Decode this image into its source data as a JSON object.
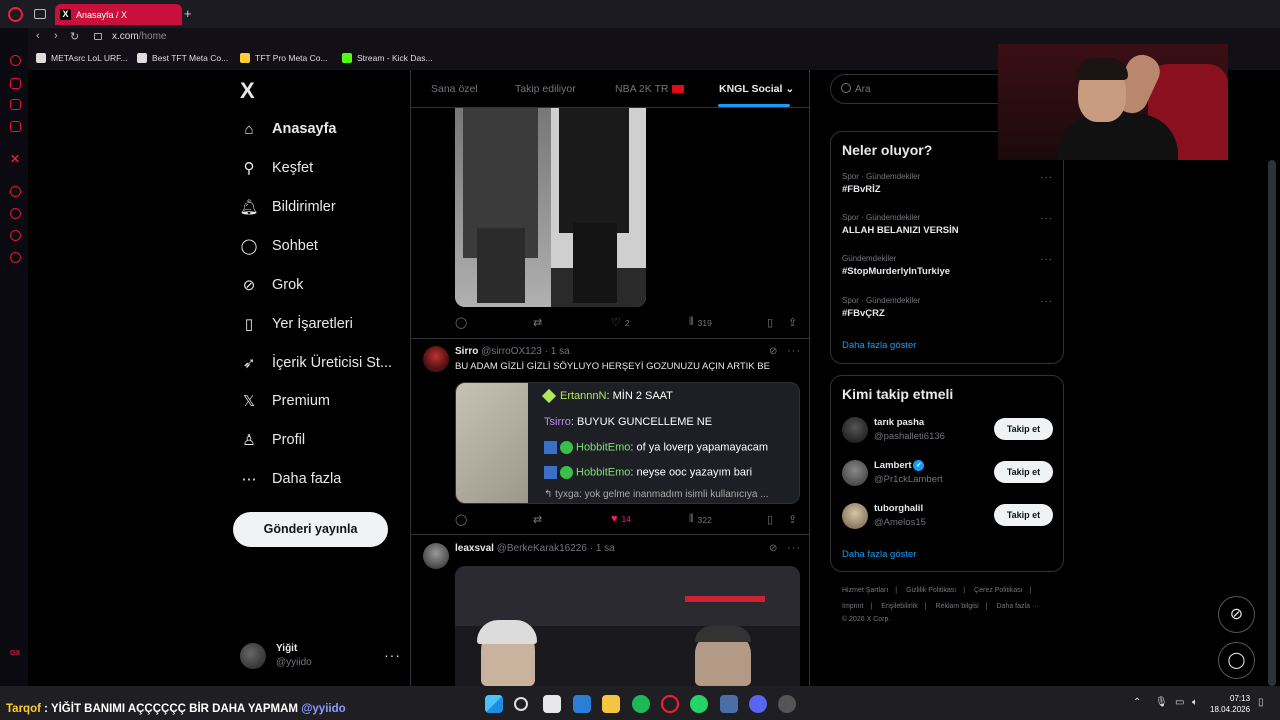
{
  "browser": {
    "tab_title": "Anasayfa / X",
    "tab_favicon": "X",
    "new_tab": "+",
    "url_host": "x.com",
    "url_path": "/home",
    "bookmarks": [
      {
        "label": "METAsrc LoL URF...",
        "color": "#ffffff"
      },
      {
        "label": "Best TFT Meta Co...",
        "color": "#ffffff"
      },
      {
        "label": "TFT Pro Meta Co...",
        "color": "#ffcc33"
      },
      {
        "label": "Stream - Kick Das...",
        "color": "#53fc18"
      }
    ],
    "sidebar_small_label": "GX"
  },
  "nav": {
    "logo": "X",
    "items": [
      {
        "label": "Anasayfa",
        "icon": "home-icon",
        "glyph": "⌂"
      },
      {
        "label": "Keşfet",
        "icon": "search-icon",
        "glyph": "⚲"
      },
      {
        "label": "Bildirimler",
        "icon": "bell-icon",
        "glyph": "🔔︎"
      },
      {
        "label": "Sohbet",
        "icon": "chat-icon",
        "glyph": "◯"
      },
      {
        "label": "Grok",
        "icon": "grok-icon",
        "glyph": "⊘"
      },
      {
        "label": "Yer İşaretleri",
        "icon": "bookmark-icon",
        "glyph": "▯"
      },
      {
        "label": "İçerik Üreticisi St...",
        "icon": "rocket-icon",
        "glyph": "➶"
      },
      {
        "label": "Premium",
        "icon": "x-premium-icon",
        "glyph": "𝕏"
      },
      {
        "label": "Profil",
        "icon": "person-icon",
        "glyph": "♙"
      },
      {
        "label": "Daha fazla",
        "icon": "more-circle-icon",
        "glyph": "⋯"
      }
    ],
    "post_button": "Gönderi yayınla",
    "account": {
      "name": "Yiğit",
      "handle": "@yyiido",
      "more": "···"
    }
  },
  "feed": {
    "tabs": [
      "Sana özel",
      "Takip ediliyor",
      "NBA 2K TR",
      "KNGL Social"
    ],
    "tab_chevron": "⌄",
    "tweets": [
      {
        "reply": "",
        "retweet": "",
        "likes": "2",
        "views": "319"
      },
      {
        "name": "Sirro",
        "handle": "@sirroOX123",
        "time": "· 1 sa",
        "text": "BU ADAM GİZLİ GİZLİ SÖYLUYO HERŞEYİ GOZUNUZU AÇIN ARTIK BE",
        "chat": [
          {
            "user": "ErtannnN",
            "msg": ": MİN 2 SAAT"
          },
          {
            "user": "Tsirro",
            "msg": ": BUYUK GUNCELLEME NE"
          },
          {
            "user": "HobbitEmo",
            "msg": ": of ya loverp yapamayacam"
          },
          {
            "user": "HobbitEmo",
            "msg": ": neyse ooc yazayım bari"
          },
          {
            "user": "tyxga",
            "msg": ": yok gelme inanmadım isimli kullanıcıya ..."
          }
        ],
        "reply": "",
        "retweet": "",
        "likes": "14",
        "views": "322"
      },
      {
        "name": "leaxsval",
        "handle": "@BerkeKarak16226",
        "time": "· 1 sa"
      }
    ]
  },
  "right": {
    "search_placeholder": "Ara",
    "trends_title": "Neler oluyor?",
    "trends": [
      {
        "meta": "Spor · Gündemdekiler",
        "name": "#FBvRİZ"
      },
      {
        "meta": "Spor · Gündemdekiler",
        "name": "ALLAH BELANIZI VERSİN"
      },
      {
        "meta": "Gündemdekiler",
        "name": "#StopMurderlyInTurkiye"
      },
      {
        "meta": "Spor · Gündemdekiler",
        "name": "#FBvÇRZ"
      }
    ],
    "trends_more": "Daha fazla göster",
    "wtf_title": "Kimi takip etmeli",
    "wtf": [
      {
        "name": "tarık pasha",
        "handle": "@pashalleti6136",
        "verified": false,
        "button": "Takip et"
      },
      {
        "name": "Lambert",
        "handle": "@Pr1ckLambert",
        "verified": true,
        "button": "Takip et"
      },
      {
        "name": "tuborghalil",
        "handle": "@Amelos15",
        "verified": false,
        "button": "Takip et"
      }
    ],
    "wtf_more": "Daha fazla göster",
    "footer_row1": [
      "Hizmet Şartları",
      "|",
      "Gizlilik Politikası",
      "|",
      "Çerez Politikası",
      "|"
    ],
    "footer_row2": [
      "Imprint",
      "|",
      "Erişilebilirlik",
      "|",
      "Reklam bilgisi",
      "|",
      "Daha fazla ···"
    ],
    "footer_copyright": "© 2026 X Corp."
  },
  "overlay": {
    "chat_user": "Tarqof",
    "chat_sep": " : ",
    "chat_msg": "YİĞİT BANIMI AÇÇÇÇÇÇ BİR DAHA YAPMAM ",
    "chat_mention": "@yyiido"
  },
  "taskbar": {
    "time": "07:13",
    "date": "18.04.2026",
    "tray_chevron": "⌃"
  },
  "colors": {
    "accent": "#1d9bf0",
    "like": "#f91880",
    "opera_red": "#ff1b2d"
  }
}
